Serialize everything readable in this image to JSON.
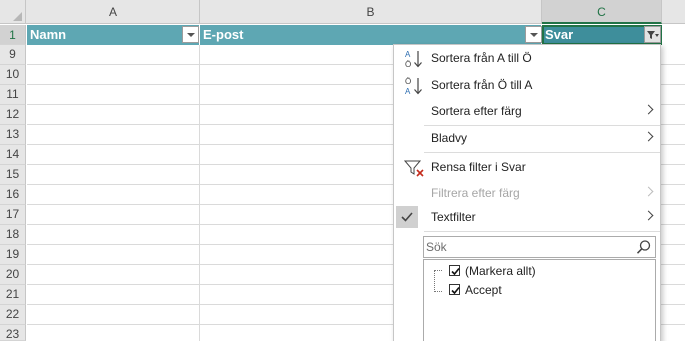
{
  "columns": [
    "A",
    "B",
    "C"
  ],
  "rows": [
    "1",
    "9",
    "10",
    "11",
    "12",
    "13",
    "14",
    "15",
    "16",
    "17",
    "18",
    "19",
    "20",
    "21",
    "22",
    "23"
  ],
  "table_headers": [
    "Namn",
    "E-post",
    "Svar"
  ],
  "filter_menu": {
    "sort_az": "Sortera från A till Ö",
    "sort_za": "Sortera från Ö till A",
    "sort_by_color": "Sortera efter färg",
    "sheet_view": "Bladvy",
    "clear_filter": "Rensa filter i Svar",
    "filter_by_color": "Filtrera efter färg",
    "text_filters": "Textfilter",
    "search_placeholder": "Sök",
    "values": [
      {
        "label": "(Markera allt)",
        "checked": true
      },
      {
        "label": "Accept",
        "checked": true
      }
    ]
  },
  "colors": {
    "table_header": "#5ea7b3",
    "active_header": "#3e8e9b",
    "selection_accent": "#217346",
    "clear_filter_x": "#c42b1c",
    "sort_icon_blue": "#2b6cb0"
  }
}
